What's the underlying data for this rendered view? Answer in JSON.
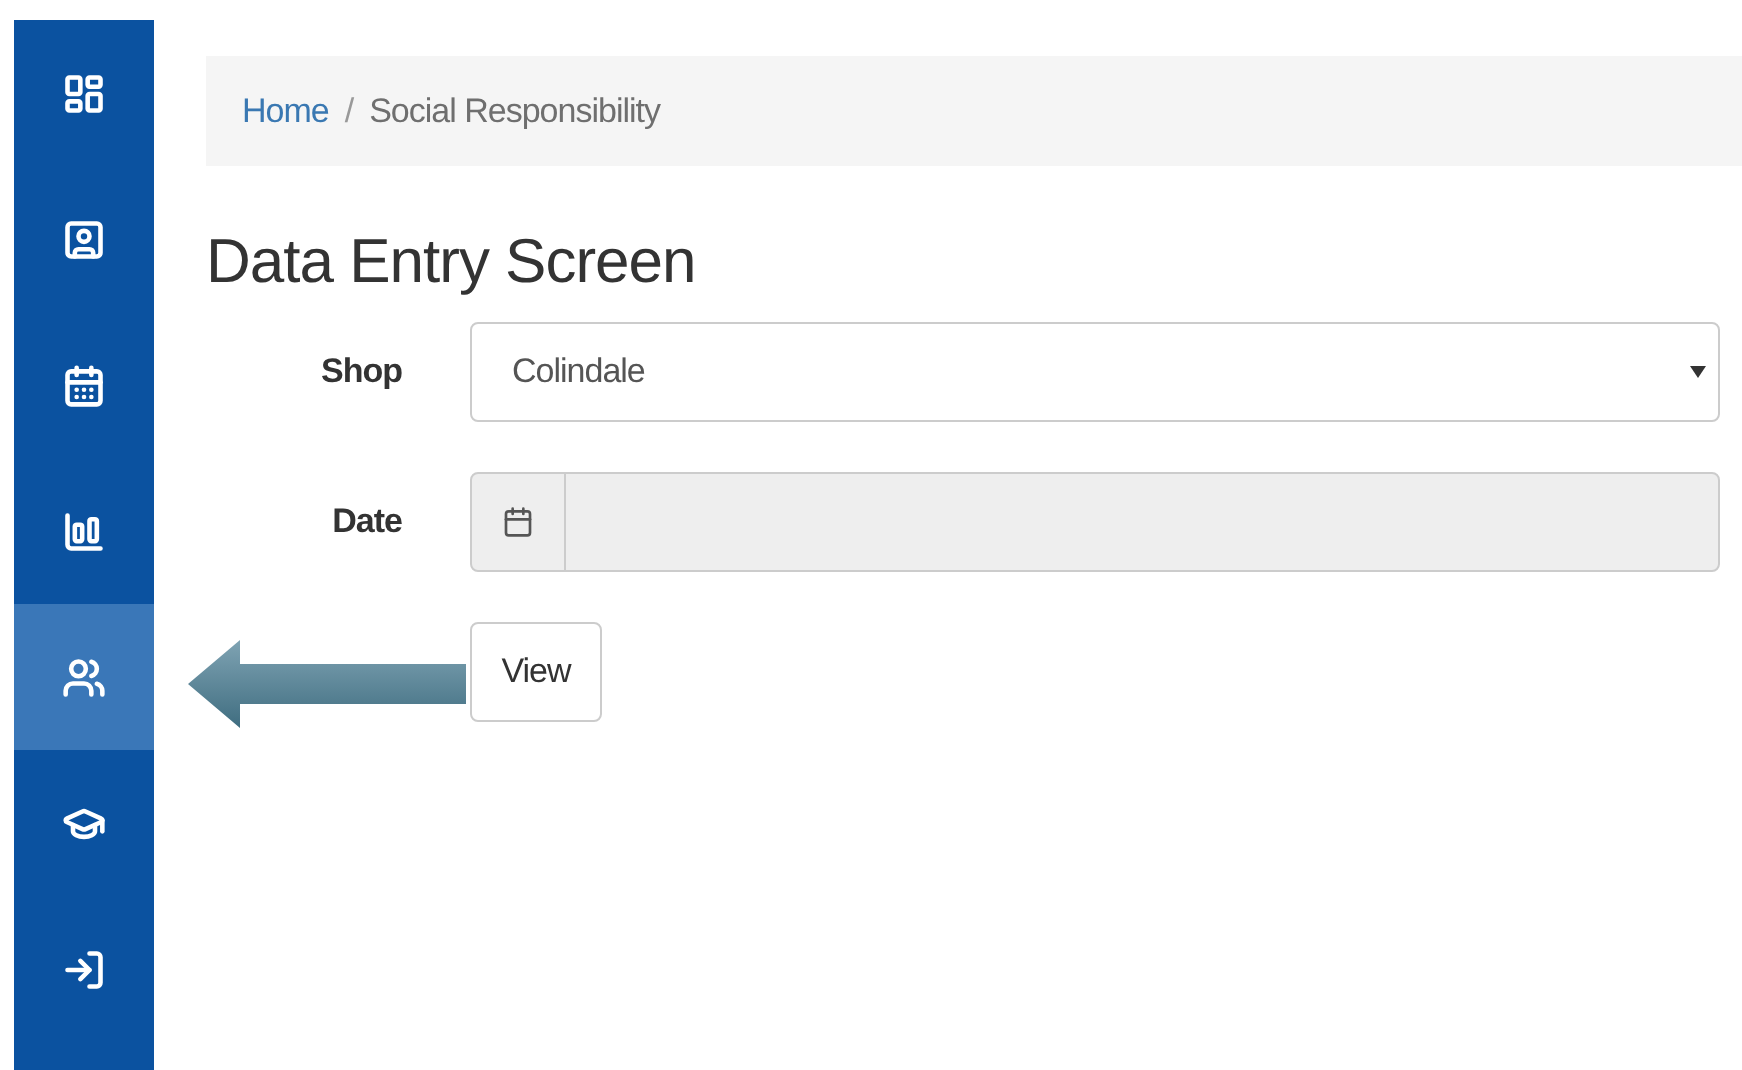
{
  "sidebar": {
    "items": [
      {
        "selected": false
      },
      {
        "selected": false
      },
      {
        "selected": false
      },
      {
        "selected": false
      },
      {
        "selected": true
      },
      {
        "selected": false
      },
      {
        "selected": false
      }
    ]
  },
  "breadcrumb": [
    {
      "label": "Home",
      "kind": "link"
    },
    {
      "label": "Social Responsibility",
      "kind": "current"
    }
  ],
  "breadcrumb_separator": "/",
  "title": "Data Entry Screen",
  "form": {
    "shop": {
      "label": "Shop",
      "value": "Colindale"
    },
    "date": {
      "label": "Date"
    }
  },
  "buttons": [
    "View"
  ]
}
